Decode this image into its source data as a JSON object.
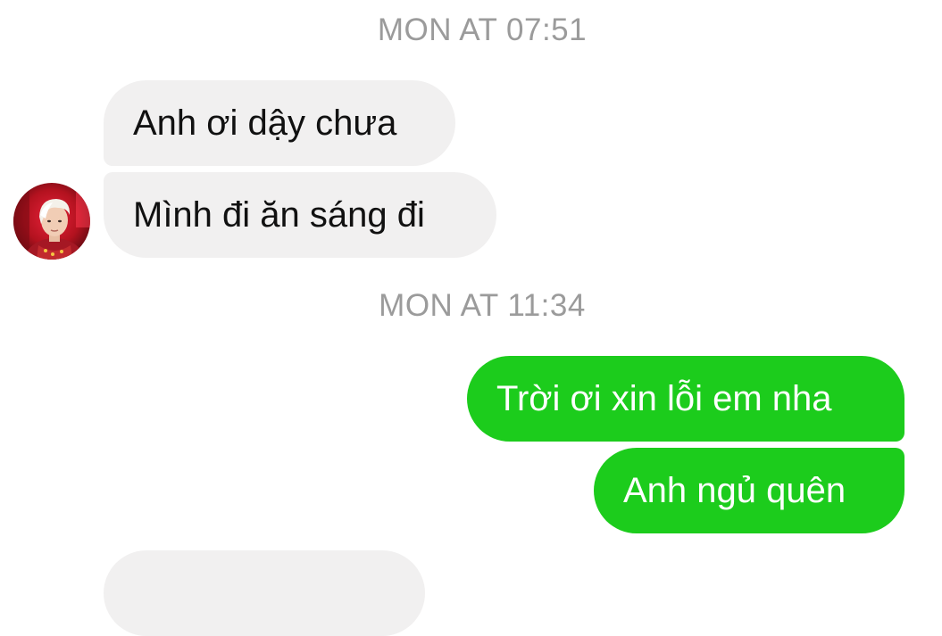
{
  "conversation": {
    "timestamp_1": "MON AT 07:51",
    "timestamp_2": "MON AT 11:34",
    "messages": [
      {
        "direction": "incoming",
        "text": "Anh ơi dậy chưa"
      },
      {
        "direction": "incoming",
        "text": "Mình đi ăn sáng đi"
      },
      {
        "direction": "outgoing",
        "text": "Trời ơi xin lỗi em nha"
      },
      {
        "direction": "outgoing",
        "text": "Anh ngủ quên"
      }
    ]
  },
  "colors": {
    "incoming_bubble": "#f1f0f0",
    "outgoing_bubble": "#1ccc1c",
    "timestamp_text": "#9b9b9b",
    "incoming_text": "#111111",
    "outgoing_text": "#ffffff"
  },
  "avatar_icon": "contact-avatar-photo"
}
